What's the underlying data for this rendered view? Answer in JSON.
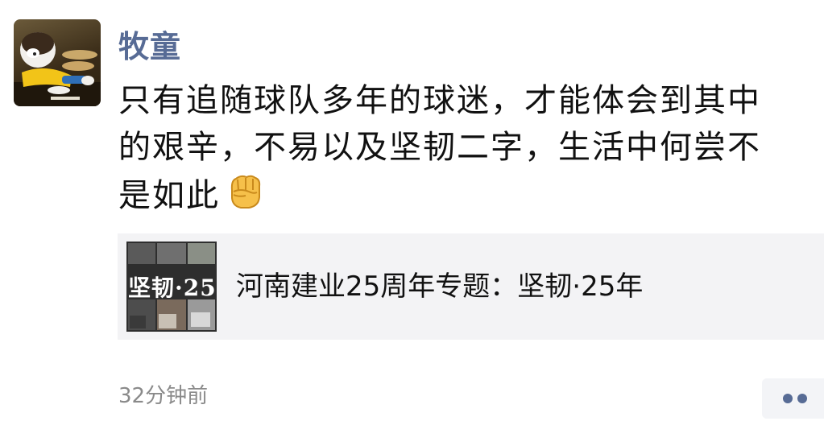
{
  "post": {
    "author": "牧童",
    "content_lines": [
      "只有追随球队多年的球迷，才能体会到其中",
      "的艰辛，不易以及坚韧二字，生活中何尝不",
      "是如此"
    ],
    "emoji": "fist-emoji",
    "link_card": {
      "title": "河南建业25周年专题：坚韧·25年",
      "thumbnail_text": "坚韧·25"
    },
    "timestamp": "32分钟前",
    "more_icon": "more-dots-icon"
  },
  "colors": {
    "author_name": "#576b95",
    "text": "#111111",
    "timestamp": "#8a8a8a",
    "card_background": "#f3f3f5",
    "dots": "#576b95"
  }
}
